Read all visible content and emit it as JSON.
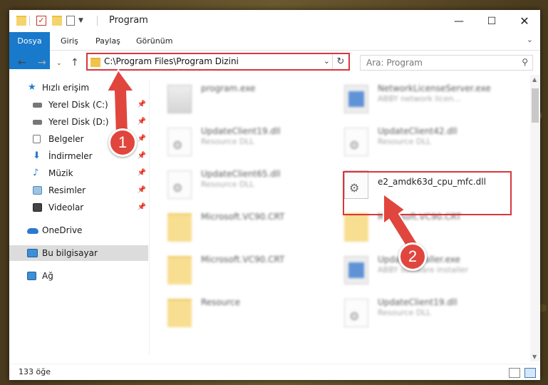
{
  "window": {
    "title": "Program"
  },
  "ribbon": {
    "tabs": [
      "Dosya",
      "Giriş",
      "Paylaş",
      "Görünüm"
    ]
  },
  "nav": {
    "address": "C:\\Program Files\\Program Dizini",
    "search_placeholder": "Ara: Program"
  },
  "sidebar": {
    "items": [
      {
        "label": "Hızlı erişim",
        "icon": "star-icon"
      },
      {
        "label": "Yerel Disk (C:)",
        "icon": "drive-icon"
      },
      {
        "label": "Yerel Disk (D:)",
        "icon": "drive-icon"
      },
      {
        "label": "Belgeler",
        "icon": "documents-icon"
      },
      {
        "label": "İndirmeler",
        "icon": "download-icon"
      },
      {
        "label": "Müzik",
        "icon": "music-icon"
      },
      {
        "label": "Resimler",
        "icon": "pictures-icon"
      },
      {
        "label": "Videolar",
        "icon": "videos-icon"
      },
      {
        "label": "OneDrive",
        "icon": "cloud-icon"
      },
      {
        "label": "Bu bilgisayar",
        "icon": "computer-icon"
      },
      {
        "label": "Ağ",
        "icon": "network-icon"
      }
    ]
  },
  "files": [
    {
      "name": "program.exe",
      "sub": ""
    },
    {
      "name": "NetworkLicenseServer.exe",
      "sub": "ABBY network licen..."
    },
    {
      "name": "UpdateClient19.dll",
      "sub": "Resource DLL"
    },
    {
      "name": "UpdateClient42.dll",
      "sub": "Resource DLL"
    },
    {
      "name": "UpdateClient65.dll",
      "sub": "Resource DLL"
    },
    {
      "name": "e2_amdk63d_cpu_mfc.dll",
      "sub": ""
    },
    {
      "name": "Microsoft.VC90.CRT",
      "sub": ""
    },
    {
      "name": "Microsoft.VC90.CRT",
      "sub": ""
    },
    {
      "name": "Microsoft.VC90.CRT",
      "sub": ""
    },
    {
      "name": "UpdateInstaller.exe",
      "sub": "ABBY software installer"
    },
    {
      "name": "Resource",
      "sub": ""
    },
    {
      "name": "UpdateClient19.dll",
      "sub": "Resource DLL"
    }
  ],
  "status": {
    "count": "133 öğe"
  },
  "annotations": {
    "step1": "1",
    "step2": "2"
  },
  "colors": {
    "accent": "#1979ca",
    "highlight": "#d9363e"
  }
}
